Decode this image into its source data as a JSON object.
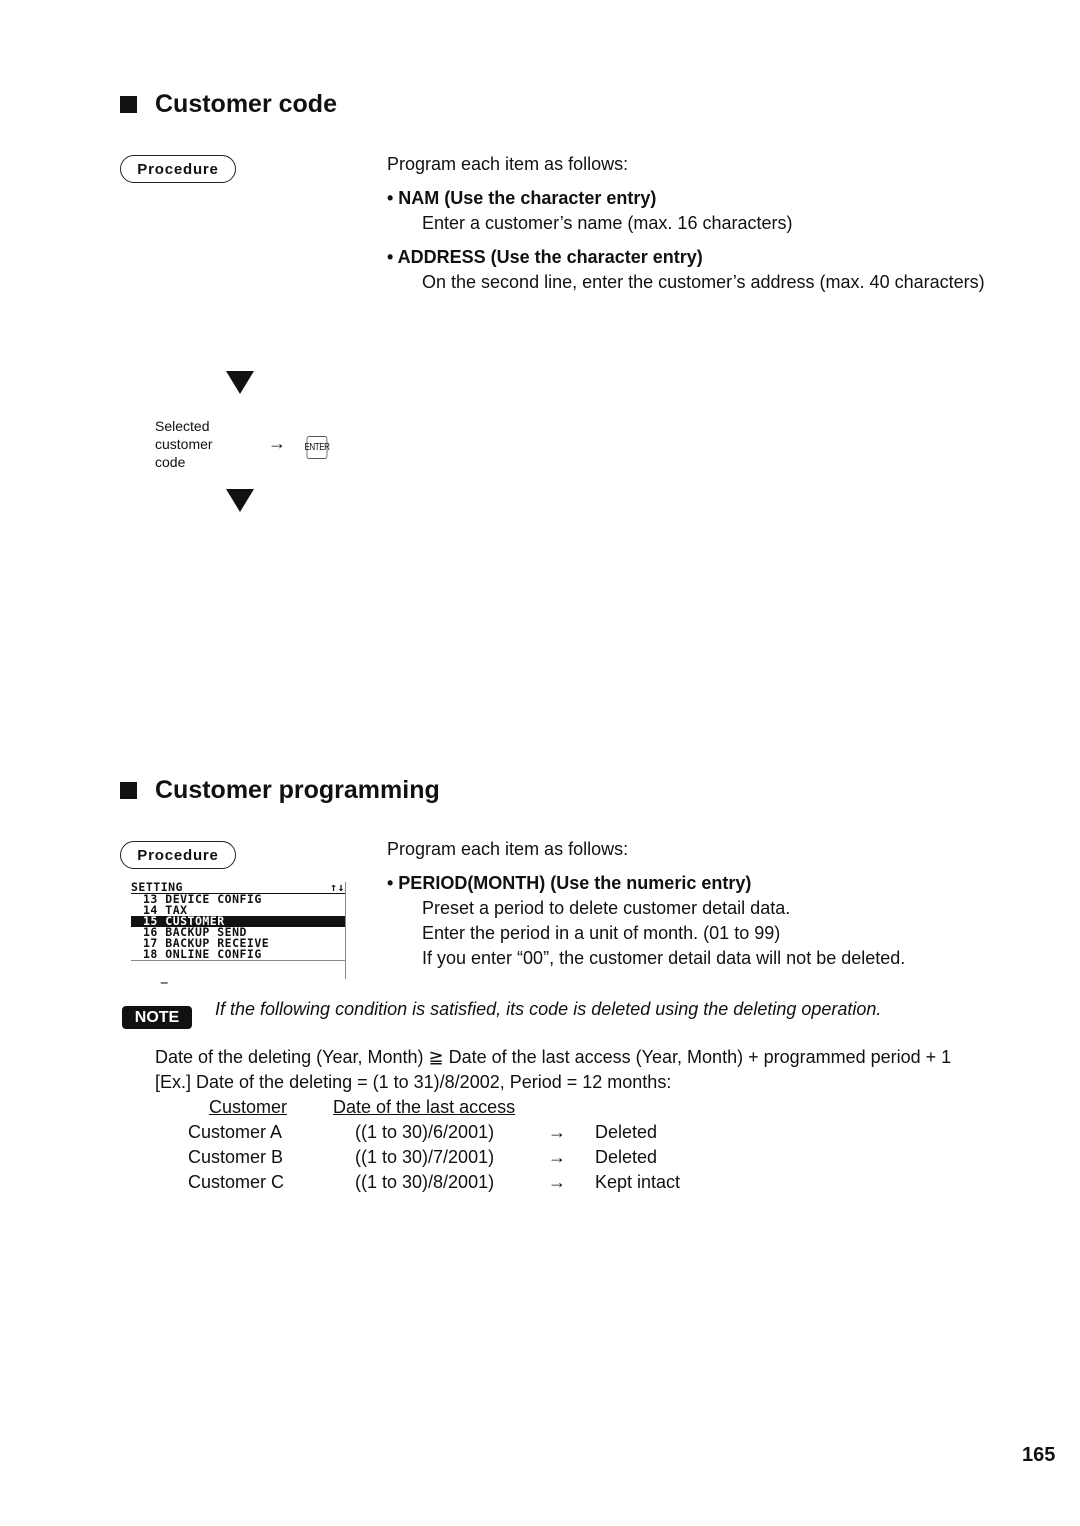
{
  "section1": {
    "title": "Customer code",
    "procedure_label": "Procedure",
    "intro": "Program each item as follows:",
    "items": [
      {
        "label": "• NAM (Use the character entry)",
        "desc": "Enter a customer’s name (max. 16 characters)"
      },
      {
        "label": "• ADDRESS (Use the character entry)",
        "desc": "On the second line, enter the customer’s address (max. 40 characters)"
      }
    ],
    "flow": {
      "step_label_lines": [
        "Selected",
        "customer",
        "code"
      ],
      "arrow": "→",
      "key_label": "ENTER",
      "down_arrow_icon": "down-triangle"
    }
  },
  "section2": {
    "title": "Customer programming",
    "procedure_label": "Procedure",
    "lcd": {
      "header": "SETTING",
      "scroll_indicator": "↑↓",
      "rows": [
        {
          "text": "13 DEVICE CONFIG",
          "selected": false
        },
        {
          "text": "14 TAX",
          "selected": false
        },
        {
          "text": "15 CUSTOMER",
          "selected": true
        },
        {
          "text": "16 BACKUP SEND",
          "selected": false
        },
        {
          "text": "17 BACKUP RECEIVE",
          "selected": false
        },
        {
          "text": "18 ONLINE CONFIG",
          "selected": false
        }
      ],
      "cursor": "_"
    },
    "intro": "Program each item as follows:",
    "item": {
      "label": "• PERIOD(MONTH) (Use the numeric entry)",
      "desc_lines": [
        "Preset a period to delete customer detail data.",
        "Enter the period in a unit of month. (01 to 99)",
        "If you enter “00”, the customer detail data will not be deleted."
      ]
    }
  },
  "note": {
    "badge": "NOTE",
    "text": "If the following condition is satisfied, its code is deleted using the deleting operation.",
    "condition": "Date of the deleting (Year, Month) ≧ Date of the last access (Year, Month) + programmed period + 1",
    "example": "[Ex.]  Date of the deleting = (1 to 31)/8/2002, Period = 12 months:",
    "table": {
      "headers": [
        "Customer",
        "Date of the last access"
      ],
      "rows": [
        {
          "customer": "Customer A",
          "date": "((1 to 30)/6/2001)",
          "arrow": "→",
          "result": "Deleted"
        },
        {
          "customer": "Customer B",
          "date": "((1 to 30)/7/2001)",
          "arrow": "→",
          "result": "Deleted"
        },
        {
          "customer": "Customer C",
          "date": "((1 to 30)/8/2001)",
          "arrow": "→",
          "result": "Kept intact"
        }
      ]
    }
  },
  "page_number": "165"
}
